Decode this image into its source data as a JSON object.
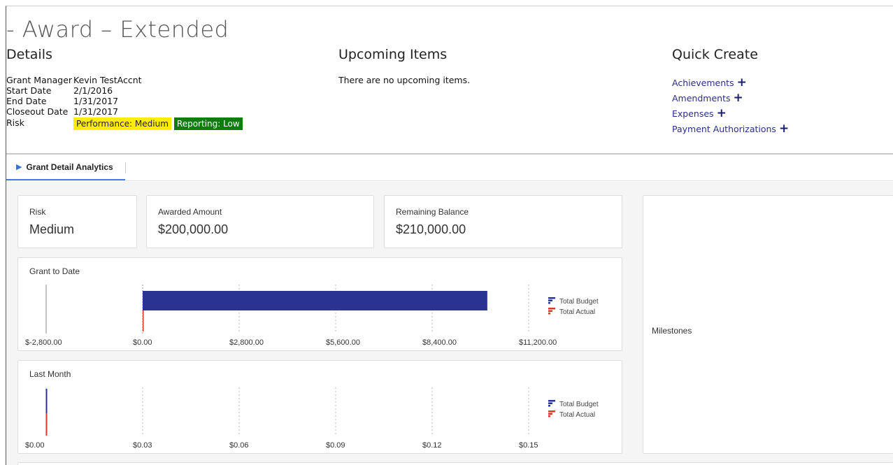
{
  "page": {
    "title": "- Award – Extended"
  },
  "details": {
    "heading": "Details",
    "rows": [
      {
        "key": "Grant Manager",
        "value": "Kevin TestAccnt"
      },
      {
        "key": "Start Date",
        "value": "2/1/2016"
      },
      {
        "key": "End Date",
        "value": "1/31/2017"
      },
      {
        "key": "Closeout Date",
        "value": "1/31/2017"
      }
    ],
    "risk_key": "Risk",
    "risk_badges": [
      {
        "text": "Performance: Medium",
        "color": "#ffee00"
      },
      {
        "text": "Reporting: Low",
        "color": "#0e7d0e"
      }
    ]
  },
  "upcoming": {
    "heading": "Upcoming Items",
    "empty_text": "There are no upcoming items."
  },
  "quick_create": {
    "heading": "Quick Create",
    "items": [
      {
        "label": "Achievements",
        "icon": "plus-icon"
      },
      {
        "label": "Amendments",
        "icon": "plus-icon"
      },
      {
        "label": "Expenses",
        "icon": "plus-icon"
      },
      {
        "label": "Payment Authorizations",
        "icon": "plus-icon"
      }
    ]
  },
  "tabs": [
    {
      "label": "Grant Detail Analytics",
      "active": true,
      "icon": "play-arrow-icon"
    }
  ],
  "kpis": {
    "risk": {
      "label": "Risk",
      "value": "Medium"
    },
    "awarded": {
      "label": "Awarded Amount",
      "value": "$200,000.00"
    },
    "remaining": {
      "label": "Remaining Balance",
      "value": "$210,000.00"
    }
  },
  "milestones": {
    "label": "Milestones"
  },
  "colors": {
    "budget": "#2a3391",
    "actual": "#d63a2a",
    "accent": "#4a7be8",
    "link": "#2a2e8a"
  },
  "chart_data": [
    {
      "type": "bar",
      "orientation": "horizontal",
      "title": "Grant to Date",
      "tick_labels": [
        "$-2,800.00",
        "$0.00",
        "$2,800.00",
        "$5,600.00",
        "$8,400.00",
        "$11,200.00"
      ],
      "xlim": [
        -2800,
        11200
      ],
      "series": [
        {
          "name": "Total Budget",
          "values": [
            10000
          ]
        },
        {
          "name": "Total Actual",
          "values": [
            0
          ]
        }
      ],
      "legend": "right",
      "grid": true
    },
    {
      "type": "bar",
      "orientation": "horizontal",
      "title": "Last Month",
      "tick_labels": [
        "$0.00",
        "$0.03",
        "$0.06",
        "$0.09",
        "$0.12",
        "$0.15"
      ],
      "xlim": [
        0,
        0.15
      ],
      "series": [
        {
          "name": "Total Budget",
          "values": [
            0
          ]
        },
        {
          "name": "Total Actual",
          "values": [
            0
          ]
        }
      ],
      "legend": "right",
      "grid": true
    }
  ]
}
